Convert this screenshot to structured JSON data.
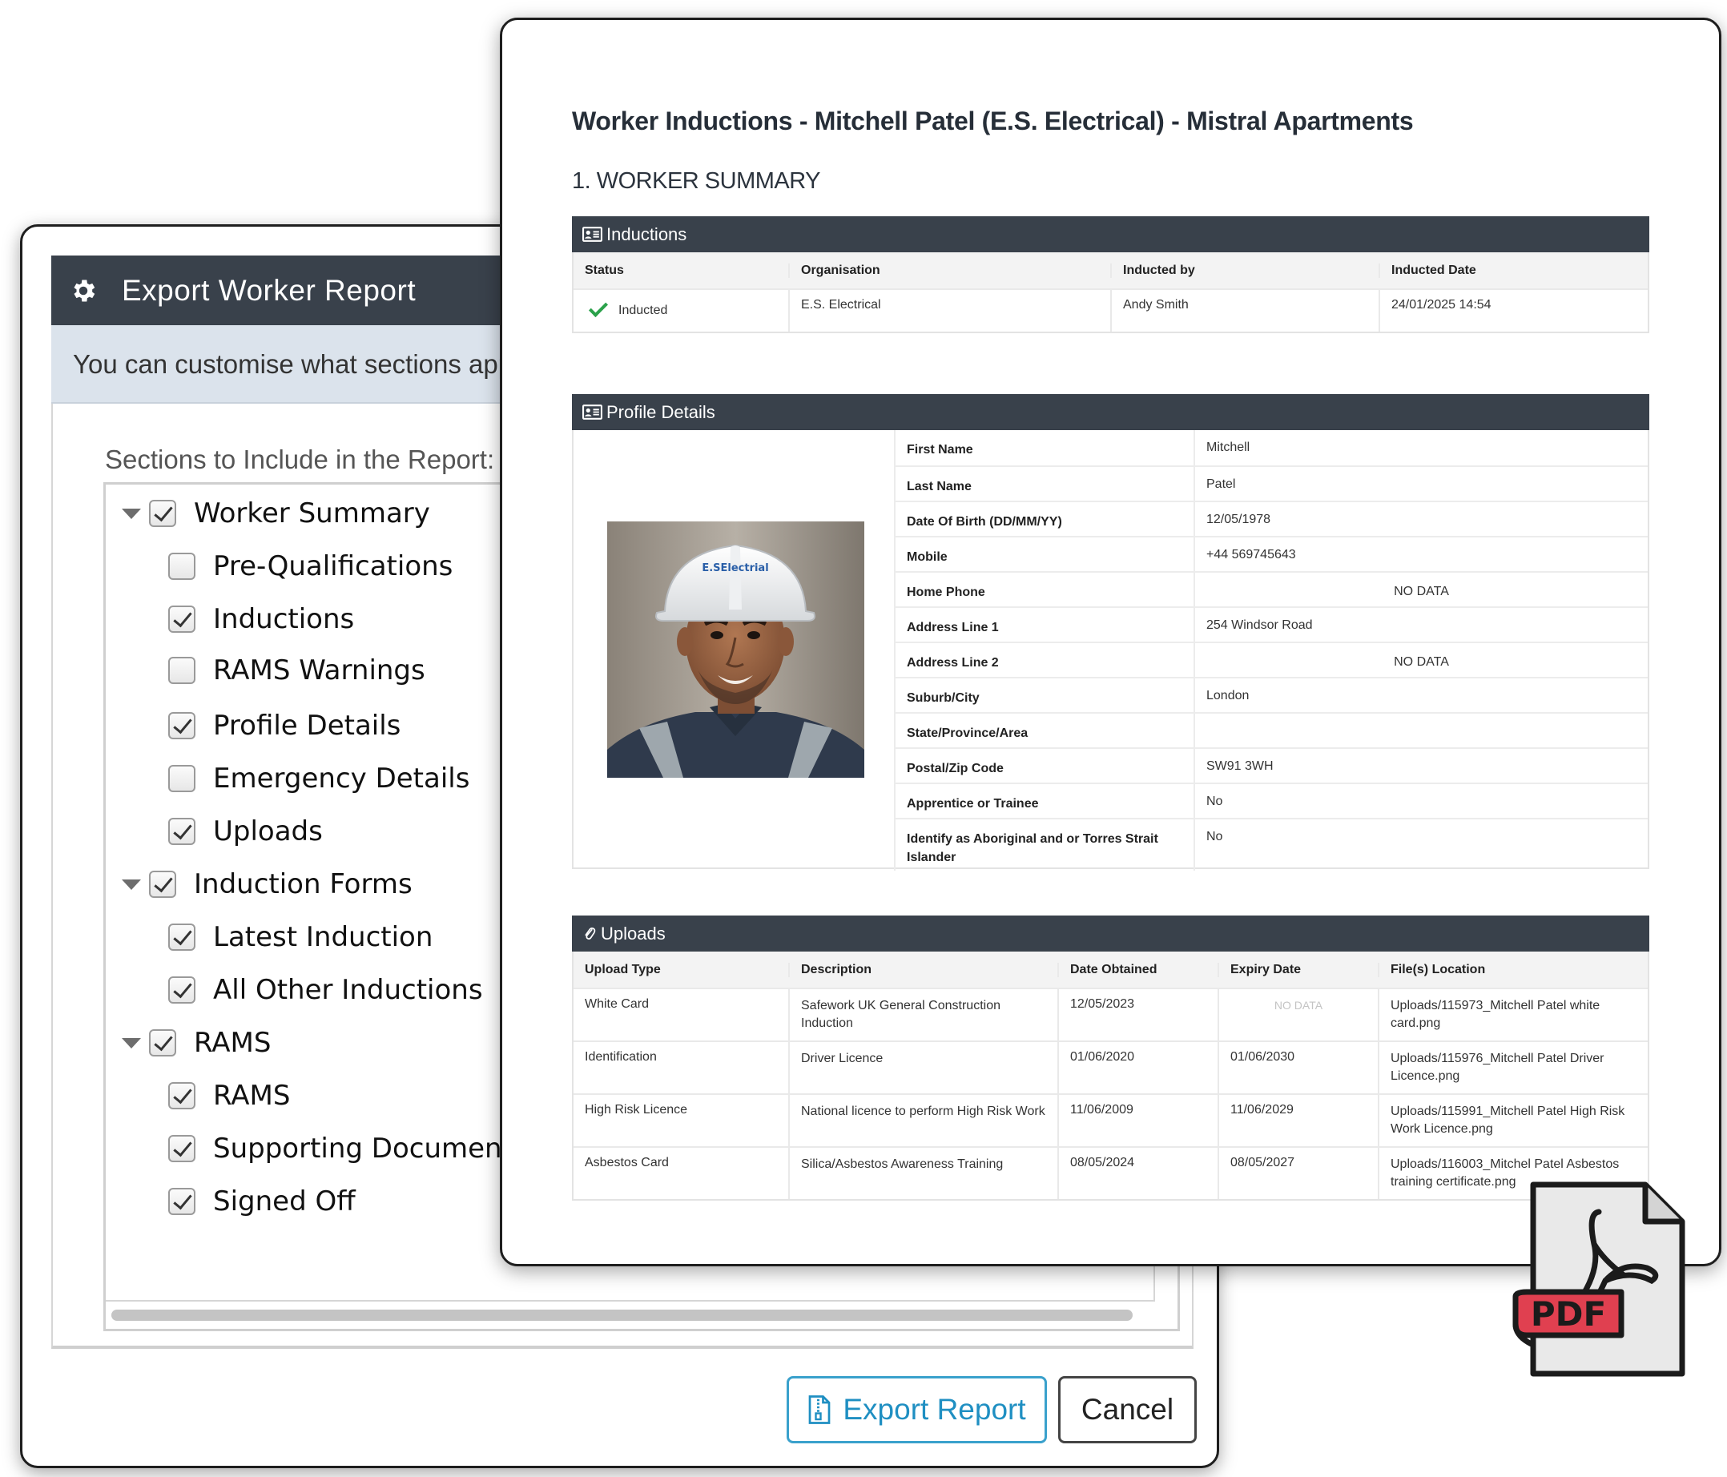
{
  "dialog": {
    "title": "Export Worker Report",
    "info_text": "You can customise what sections appear",
    "sections_label": "Sections to Include in the Report:",
    "tree": [
      {
        "label": "Worker Summary",
        "checked": true,
        "level": 0,
        "expanded": true
      },
      {
        "label": "Pre-Qualifications",
        "checked": false,
        "level": 1
      },
      {
        "label": "Inductions",
        "checked": true,
        "level": 1
      },
      {
        "label": "RAMS Warnings",
        "checked": false,
        "level": 1
      },
      {
        "label": "Profile Details",
        "checked": true,
        "level": 1
      },
      {
        "label": "Emergency Details",
        "checked": false,
        "level": 1
      },
      {
        "label": "Uploads",
        "checked": true,
        "level": 1
      },
      {
        "label": "Induction Forms",
        "checked": true,
        "level": 0,
        "expanded": true
      },
      {
        "label": "Latest Induction",
        "checked": true,
        "level": 1
      },
      {
        "label": "All Other Inductions",
        "checked": true,
        "level": 1
      },
      {
        "label": "RAMS",
        "checked": true,
        "level": 0,
        "expanded": true
      },
      {
        "label": "RAMS",
        "checked": true,
        "level": 1
      },
      {
        "label": "Supporting Documents",
        "checked": true,
        "level": 1
      },
      {
        "label": "Signed Off",
        "checked": true,
        "level": 1
      }
    ],
    "export_button": "Export Report",
    "cancel_button": "Cancel"
  },
  "report": {
    "title": "Worker Inductions - Mitchell Patel (E.S. Electrical) - Mistral Apartments",
    "section_heading": "1. WORKER SUMMARY",
    "inductions": {
      "heading": "Inductions",
      "columns": [
        "Status",
        "Organisation",
        "Inducted by",
        "Inducted Date"
      ],
      "rows": [
        [
          "Inducted",
          "E.S. Electrical",
          "Andy Smith",
          "24/01/2025 14:54"
        ]
      ]
    },
    "profile": {
      "heading": "Profile Details",
      "photo_helmet_text": "E.SElectrial",
      "fields": [
        {
          "label": "First Name",
          "value": "Mitchell"
        },
        {
          "label": "Last Name",
          "value": "Patel"
        },
        {
          "label": "Date Of Birth (DD/MM/YY)",
          "value": "12/05/1978"
        },
        {
          "label": "Mobile",
          "value": "+44 569745643"
        },
        {
          "label": "Home Phone",
          "value": "NO DATA"
        },
        {
          "label": "Address Line 1",
          "value": "254 Windsor Road"
        },
        {
          "label": "Address Line 2",
          "value": "NO DATA"
        },
        {
          "label": "Suburb/City",
          "value": "London"
        },
        {
          "label": "State/Province/Area",
          "value": ""
        },
        {
          "label": "Postal/Zip Code",
          "value": "SW91 3WH"
        },
        {
          "label": "Apprentice or Trainee",
          "value": "No"
        },
        {
          "label": "Identify as Aboriginal and or Torres Strait Islander",
          "value": "No"
        }
      ]
    },
    "uploads": {
      "heading": "Uploads",
      "columns": [
        "Upload Type",
        "Description",
        "Date Obtained",
        "Expiry Date",
        "File(s) Location"
      ],
      "rows": [
        [
          "White Card",
          "Safework UK General Construction Induction",
          "12/05/2023",
          "NO DATA",
          "Uploads/115973_Mitchell Patel white card.png"
        ],
        [
          "Identification",
          "Driver Licence",
          "01/06/2020",
          "01/06/2030",
          "Uploads/115976_Mitchell Patel Driver Licence.png"
        ],
        [
          "High Risk Licence",
          "National licence to perform High Risk Work",
          "11/06/2009",
          "11/06/2029",
          "Uploads/115991_Mitchell Patel High Risk Work Licence.png"
        ],
        [
          "Asbestos Card",
          "Silica/Asbestos Awareness Training",
          "08/05/2024",
          "08/05/2027",
          "Uploads/116003_Mitchel Patel Asbestos training certificate.png"
        ]
      ]
    }
  },
  "pdf_badge": {
    "label": "PDF",
    "color": "#e04050"
  }
}
